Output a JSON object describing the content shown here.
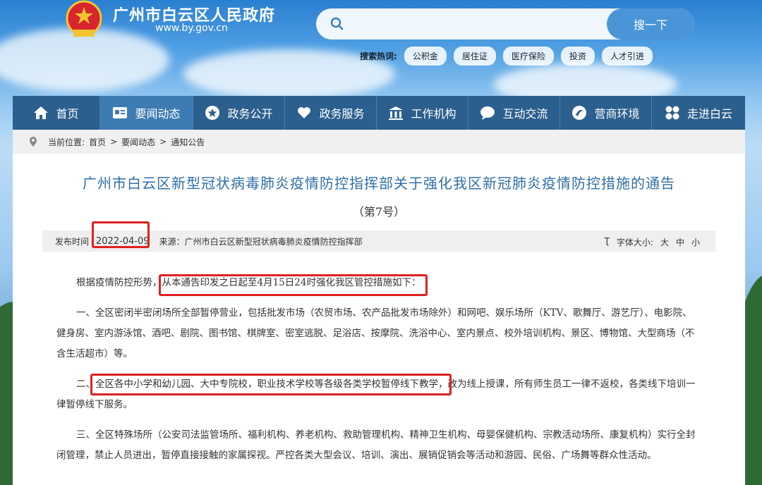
{
  "header": {
    "site_name": "广州市白云区人民政府",
    "site_url": "www.by.gov.cn",
    "search_button": "搜一下",
    "hot_label": "搜索热词:",
    "hot_tags": [
      "公积金",
      "居住证",
      "医疗保险",
      "投资",
      "人才引进"
    ]
  },
  "nav": {
    "items": [
      {
        "label": "首页",
        "icon": "home-icon"
      },
      {
        "label": "要闻动态",
        "icon": "news-icon"
      },
      {
        "label": "政务公开",
        "icon": "star-icon"
      },
      {
        "label": "政务服务",
        "icon": "heart-icon"
      },
      {
        "label": "工作机构",
        "icon": "building-icon"
      },
      {
        "label": "互动交流",
        "icon": "chat-icon"
      },
      {
        "label": "营商环境",
        "icon": "business-icon"
      },
      {
        "label": "走进白云",
        "icon": "grid-icon"
      }
    ]
  },
  "breadcrumb": {
    "prefix": "当前位置:",
    "items": [
      "首页",
      ">",
      "要闻动态",
      ">",
      "通知公告"
    ]
  },
  "article": {
    "title": "广州市白云区新型冠状病毒肺炎疫情防控指挥部关于强化我区新冠肺炎疫情防控措施的通告",
    "subtitle": "（第7号）",
    "publish_label": "发布时间",
    "publish_date": "2022-04-09",
    "source": "来源：广州市白云区新型冠状病毒肺炎疫情防控指挥部",
    "font_label": "字体大小:",
    "font_sizes": [
      "大",
      "中",
      "小"
    ],
    "paragraphs": [
      "根据疫情防控形势，从本通告印发之日起至4月15日24时强化我区管控措施如下：",
      "一、全区密闭半密闭场所全部暂停营业，包括批发市场（农贸市场、农产品批发市场除外）和网吧、娱乐场所（KTV、歌舞厅、游艺厅）、电影院、健身房、室内游泳馆、酒吧、剧院、图书馆、棋牌室、密室逃脱、足浴店、按摩院、洗浴中心、室内景点、校外培训机构、景区、博物馆、大型商场（不含生活超市）等。",
      "二、全区各中小学和幼儿园、大中专院校，职业技术学校等各级各类学校暂停线下教学，改为线上授课，所有师生员工一律不返校，各类线下培训一律暂停线下服务。",
      "三、全区特殊场所（公安司法监管场所、福利机构、养老机构、救助管理机构、精神卫生机构、母婴保健机构、宗教活动场所、康复机构）实行全封闭管理，禁止人员进出，暂停直接接触的家属探视。严控各类大型会议、培训、演出、展销促销会等活动和游园、民俗、广场舞等群众性活动。"
    ]
  },
  "colors": {
    "nav_bg": "#2b5f8e",
    "title": "#2f6fa7",
    "highlight": "#e02020"
  }
}
